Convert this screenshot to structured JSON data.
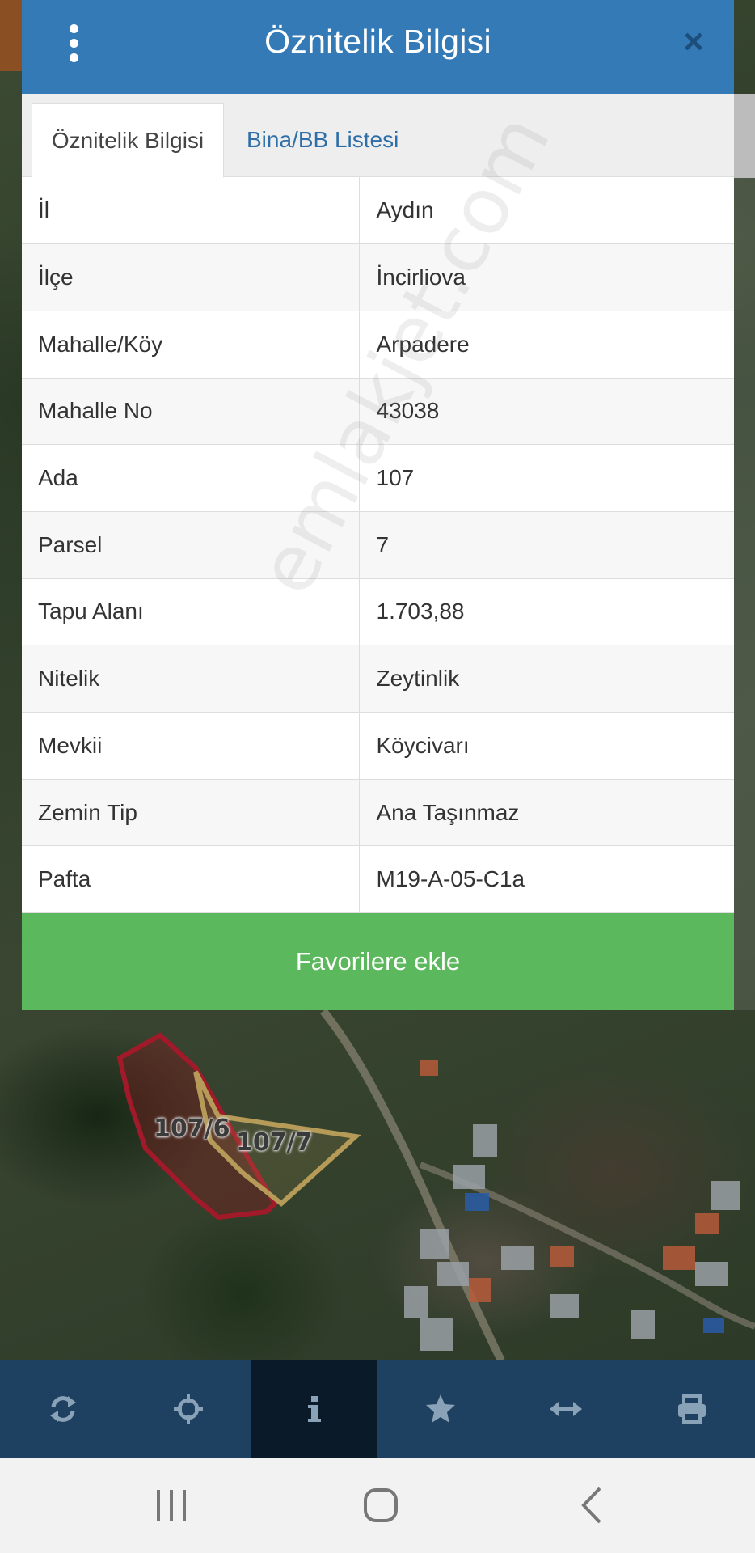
{
  "popup": {
    "title": "Öznitelik Bilgisi",
    "close_icon": "×",
    "tabs": [
      {
        "label": "Öznitelik Bilgisi",
        "active": true
      },
      {
        "label": "Bina/BB Listesi",
        "active": false
      }
    ],
    "rows": [
      {
        "key": "İl",
        "value": "Aydın"
      },
      {
        "key": "İlçe",
        "value": "İncirliova"
      },
      {
        "key": "Mahalle/Köy",
        "value": "Arpadere"
      },
      {
        "key": "Mahalle No",
        "value": "43038"
      },
      {
        "key": "Ada",
        "value": "107"
      },
      {
        "key": "Parsel",
        "value": "7"
      },
      {
        "key": "Tapu Alanı",
        "value": "1.703,88"
      },
      {
        "key": "Nitelik",
        "value": "Zeytinlik"
      },
      {
        "key": "Mevkii",
        "value": "Köycivarı"
      },
      {
        "key": "Zemin Tip",
        "value": "Ana Taşınmaz"
      },
      {
        "key": "Pafta",
        "value": "M19-A-05-C1a"
      }
    ],
    "favorite_button": "Favorilere ekle",
    "watermark": "emlakjet.com"
  },
  "map": {
    "parcel_labels": [
      "107/6",
      "107/7"
    ],
    "parcel_colors": {
      "red": "#a01a2a",
      "tan": "#b59a58"
    }
  },
  "toolbar": {
    "items": [
      {
        "icon": "refresh-icon",
        "active": false
      },
      {
        "icon": "crosshair-icon",
        "active": false
      },
      {
        "icon": "info-icon",
        "active": true
      },
      {
        "icon": "star-icon",
        "active": false
      },
      {
        "icon": "measure-arrows-icon",
        "active": false
      },
      {
        "icon": "print-icon",
        "active": false
      }
    ],
    "icon_color": "#8aa2b8"
  },
  "navbar": {
    "items": [
      "recents-icon",
      "home-icon",
      "back-icon"
    ]
  }
}
